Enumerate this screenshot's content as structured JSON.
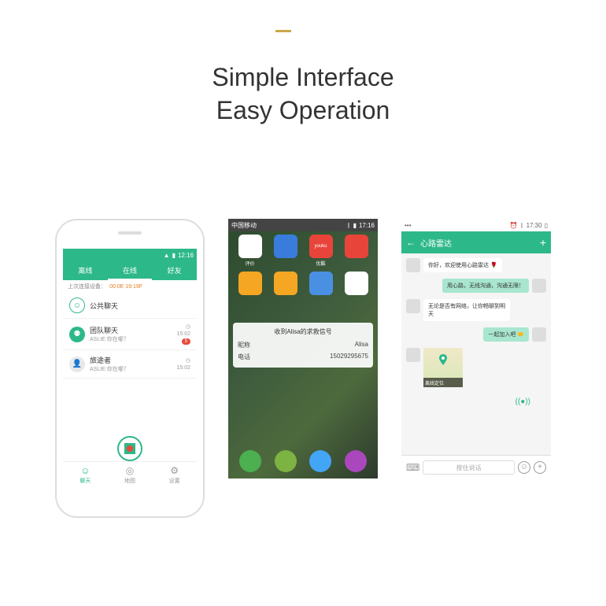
{
  "accent": "#c9a84a",
  "headline": {
    "line1": "Simple Interface",
    "line2": "Easy Operation"
  },
  "phone1": {
    "statusbar_time": "12:16",
    "tabs": [
      "离线",
      "在线",
      "好友"
    ],
    "info_label": "上次连接设备：",
    "info_time": "00:0E 19:19F",
    "chats": [
      {
        "title": "公共聊天",
        "sub": "",
        "time": "",
        "badge": ""
      },
      {
        "title": "团队聊天",
        "sub": "ASLIE:你在哪？",
        "time": "15:02",
        "badge": "5"
      },
      {
        "title": "旅途者",
        "sub": "ASLIE:你在哪？",
        "time": "15:02",
        "badge": ""
      }
    ],
    "nav": [
      {
        "label": "聊天",
        "icon": "☺"
      },
      {
        "label": "地图",
        "icon": "◎"
      },
      {
        "label": "设置",
        "icon": "⚙"
      }
    ]
  },
  "phone2": {
    "statusbar_left": "中国移动",
    "statusbar_time": "17:16",
    "apps_row1": [
      {
        "label": "评价",
        "color": "#fff"
      },
      {
        "label": "",
        "color": "#3a7cdb"
      },
      {
        "label": "优酷",
        "color": "#e8443a"
      },
      {
        "label": "",
        "color": "#e8443a"
      }
    ],
    "apps_row2": [
      {
        "label": "",
        "color": "#f5a623"
      },
      {
        "label": "",
        "color": "#f5a623"
      },
      {
        "label": "",
        "color": "#4a90e2"
      },
      {
        "label": "",
        "color": "#fff"
      }
    ],
    "notif_title": "收到Alisa的求救信号",
    "notif_rows": [
      {
        "k": "昵称",
        "v": "Alisa"
      },
      {
        "k": "电话",
        "v": "15029295675"
      }
    ],
    "dock_colors": [
      "#4caf50",
      "#7cb342",
      "#42a5f5",
      "#ab47bc"
    ]
  },
  "phone3": {
    "statusbar_time": "17:30",
    "header_title": "心路雷达",
    "messages": [
      {
        "side": "left",
        "text": "你好，欢迎使用心路雷达 🌹"
      },
      {
        "side": "right",
        "text": "用心路，无线沟通，沟通无限！"
      },
      {
        "side": "left",
        "text": "无论是否有网络，让你畅聊到明天"
      },
      {
        "side": "right",
        "text": "一起加入吧 🤝"
      },
      {
        "side": "left",
        "type": "image",
        "label": "离线定位"
      }
    ],
    "input_placeholder": "按住说话"
  }
}
